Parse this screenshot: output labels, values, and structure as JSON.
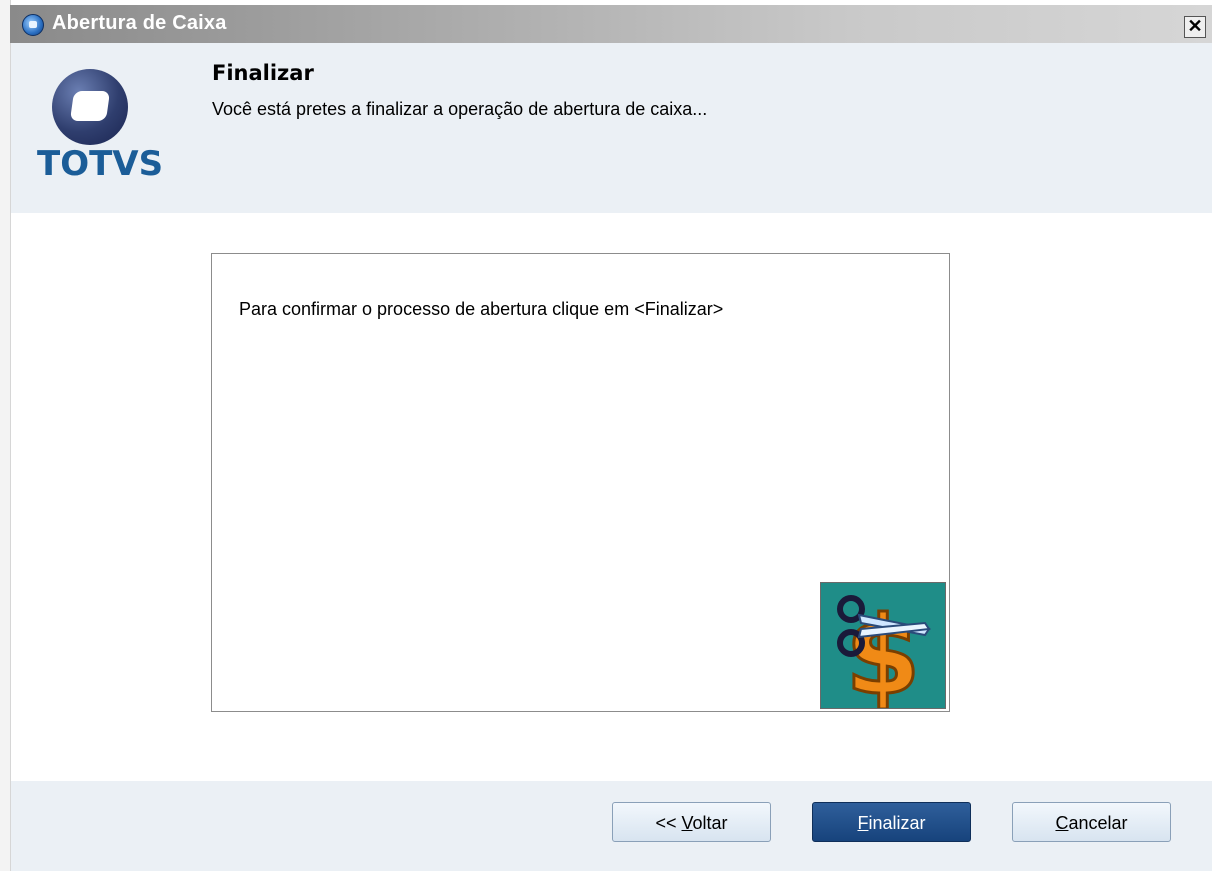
{
  "window": {
    "title": "Abertura de Caixa",
    "close_glyph": "✕"
  },
  "header": {
    "logo_text": "TOTVS",
    "title": "Finalizar",
    "subtitle": "Você está pretes a finalizar a operação de abertura de caixa..."
  },
  "panel": {
    "message": "Para confirmar o processo de abertura clique em <Finalizar>",
    "icon": "scissors-dollar-icon",
    "icon_bg": "#1f8d88",
    "dollar_color": "#f08a16"
  },
  "buttons": {
    "back": {
      "prefix": "<< ",
      "accel": "V",
      "rest": "oltar"
    },
    "finish": {
      "accel": "F",
      "rest": "inalizar"
    },
    "cancel": {
      "accel": "C",
      "rest": "ancelar"
    }
  },
  "colors": {
    "header_bg": "#ebf0f5",
    "logo_blue": "#1b5d98",
    "primary_button": "#17437c"
  }
}
